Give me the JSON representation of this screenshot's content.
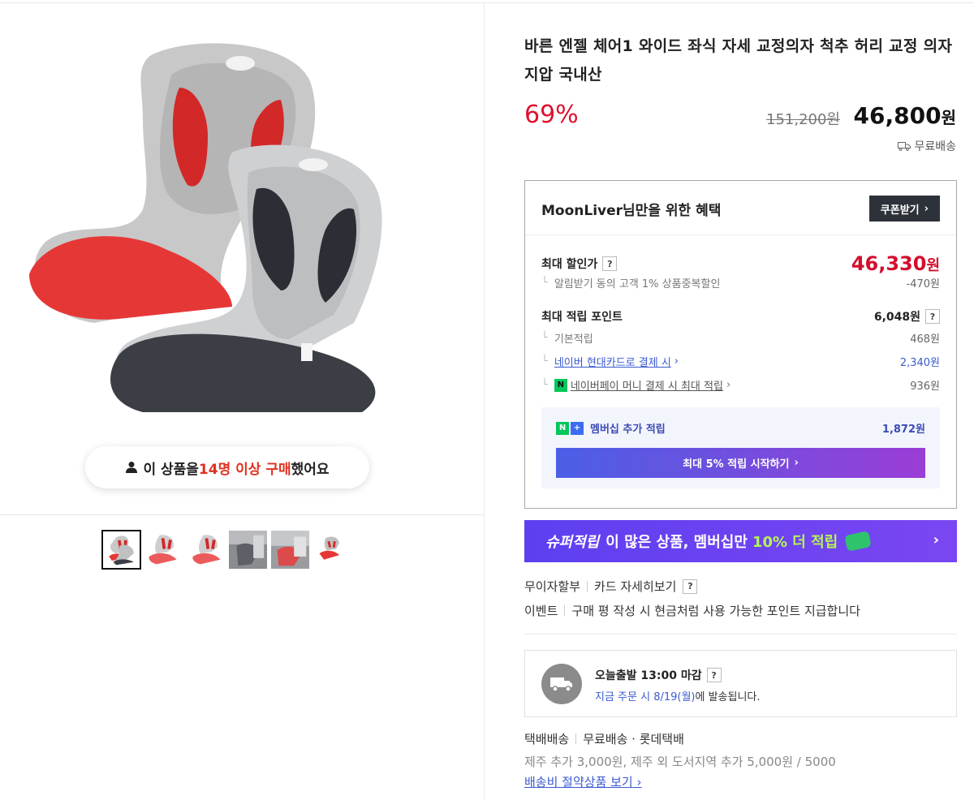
{
  "product": {
    "title": "바른 엔젤 체어1 와이드 좌식 자세 교정의자 척추 허리 교정 의자 지압 국내산",
    "discount_rate": "69%",
    "original_price": "151,200원",
    "sale_price": "46,800",
    "sale_currency": "원",
    "shipping_tag": "무료배송"
  },
  "buyers": {
    "prefix": "이 상품을 ",
    "highlight": "14명 이상 구매",
    "suffix": " 했어요"
  },
  "thumbnails": [
    "thumb-1",
    "thumb-2",
    "thumb-3",
    "thumb-4",
    "thumb-5",
    "thumb-6"
  ],
  "benefit": {
    "title": "MoonLiver님만을 위한 혜택",
    "coupon_label": "쿠폰받기",
    "max_discount_label": "최대 할인가",
    "max_discount_value": "46,330",
    "max_discount_currency": "원",
    "discount_note": "알림받기 동의 고객 1% 상품중복할인",
    "discount_note_value": "-470원",
    "max_points_label": "최대 적립 포인트",
    "max_points_value": "6,048원",
    "basic_points_label": "기본적립",
    "basic_points_value": "468원",
    "card_points_label": "네이버 현대카드로 결제 시",
    "card_points_value": "2,340원",
    "npay_points_label": "네이버페이 머니 결제 시 최대 적립",
    "npay_points_value": "936원",
    "membership_label": "멤버십 추가 적립",
    "membership_value": "1,872원",
    "membership_cta": "최대 5% 적립 시작하기",
    "question_mark": "?"
  },
  "super_banner": {
    "brand": "슈퍼적립",
    "text": "이 많은 상품, 멤버십만",
    "highlight": "10% 더 적립"
  },
  "installment": {
    "label": "무이자할부",
    "link": "카드 자세히보기"
  },
  "event": {
    "label": "이벤트",
    "text": "구매 평 작성 시 현금처럼 사용 가능한 포인트 지급합니다"
  },
  "dispatch": {
    "title": "오늘출발 13:00 마감",
    "sub_highlight": "지금 주문 시 8/19(월)",
    "sub_rest": "에 발송됩니다."
  },
  "shipping": {
    "method": "택배배송",
    "detail": "무료배송 · 롯데택배",
    "note": "제주 추가 3,000원, 제주 외 도서지역 추가 5,000원 / 5000",
    "link": "배송비 절약상품 보기"
  },
  "colors": {
    "discount_red": "#e0102f",
    "link_blue": "#3b5ad0",
    "banner_purple": "#5e3ff0",
    "coupon_dark": "#2d3139"
  }
}
